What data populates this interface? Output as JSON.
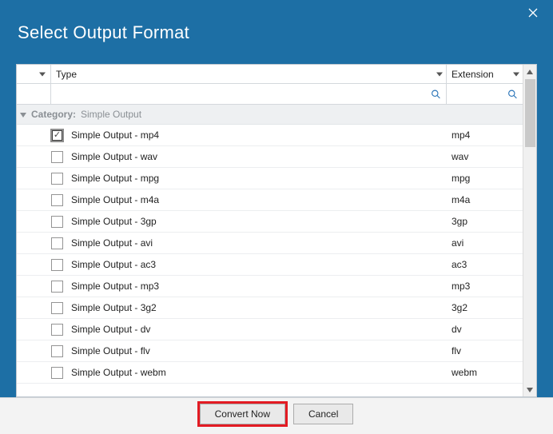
{
  "dialog": {
    "title": "Select Output Format"
  },
  "columns": {
    "type": "Type",
    "ext": "Extension"
  },
  "group": {
    "label": "Category:",
    "value": "Simple Output"
  },
  "search": {
    "placeholder": ""
  },
  "rows": [
    {
      "checked": true,
      "type": "Simple Output - mp4",
      "ext": "mp4"
    },
    {
      "checked": false,
      "type": "Simple Output - wav",
      "ext": "wav"
    },
    {
      "checked": false,
      "type": "Simple Output - mpg",
      "ext": "mpg"
    },
    {
      "checked": false,
      "type": "Simple Output - m4a",
      "ext": "m4a"
    },
    {
      "checked": false,
      "type": "Simple Output - 3gp",
      "ext": "3gp"
    },
    {
      "checked": false,
      "type": "Simple Output - avi",
      "ext": "avi"
    },
    {
      "checked": false,
      "type": "Simple Output - ac3",
      "ext": "ac3"
    },
    {
      "checked": false,
      "type": "Simple Output - mp3",
      "ext": "mp3"
    },
    {
      "checked": false,
      "type": "Simple Output - 3g2",
      "ext": "3g2"
    },
    {
      "checked": false,
      "type": "Simple Output - dv",
      "ext": "dv"
    },
    {
      "checked": false,
      "type": "Simple Output - flv",
      "ext": "flv"
    },
    {
      "checked": false,
      "type": "Simple Output - webm",
      "ext": "webm"
    }
  ],
  "buttons": {
    "convert": "Convert Now",
    "cancel": "Cancel"
  }
}
